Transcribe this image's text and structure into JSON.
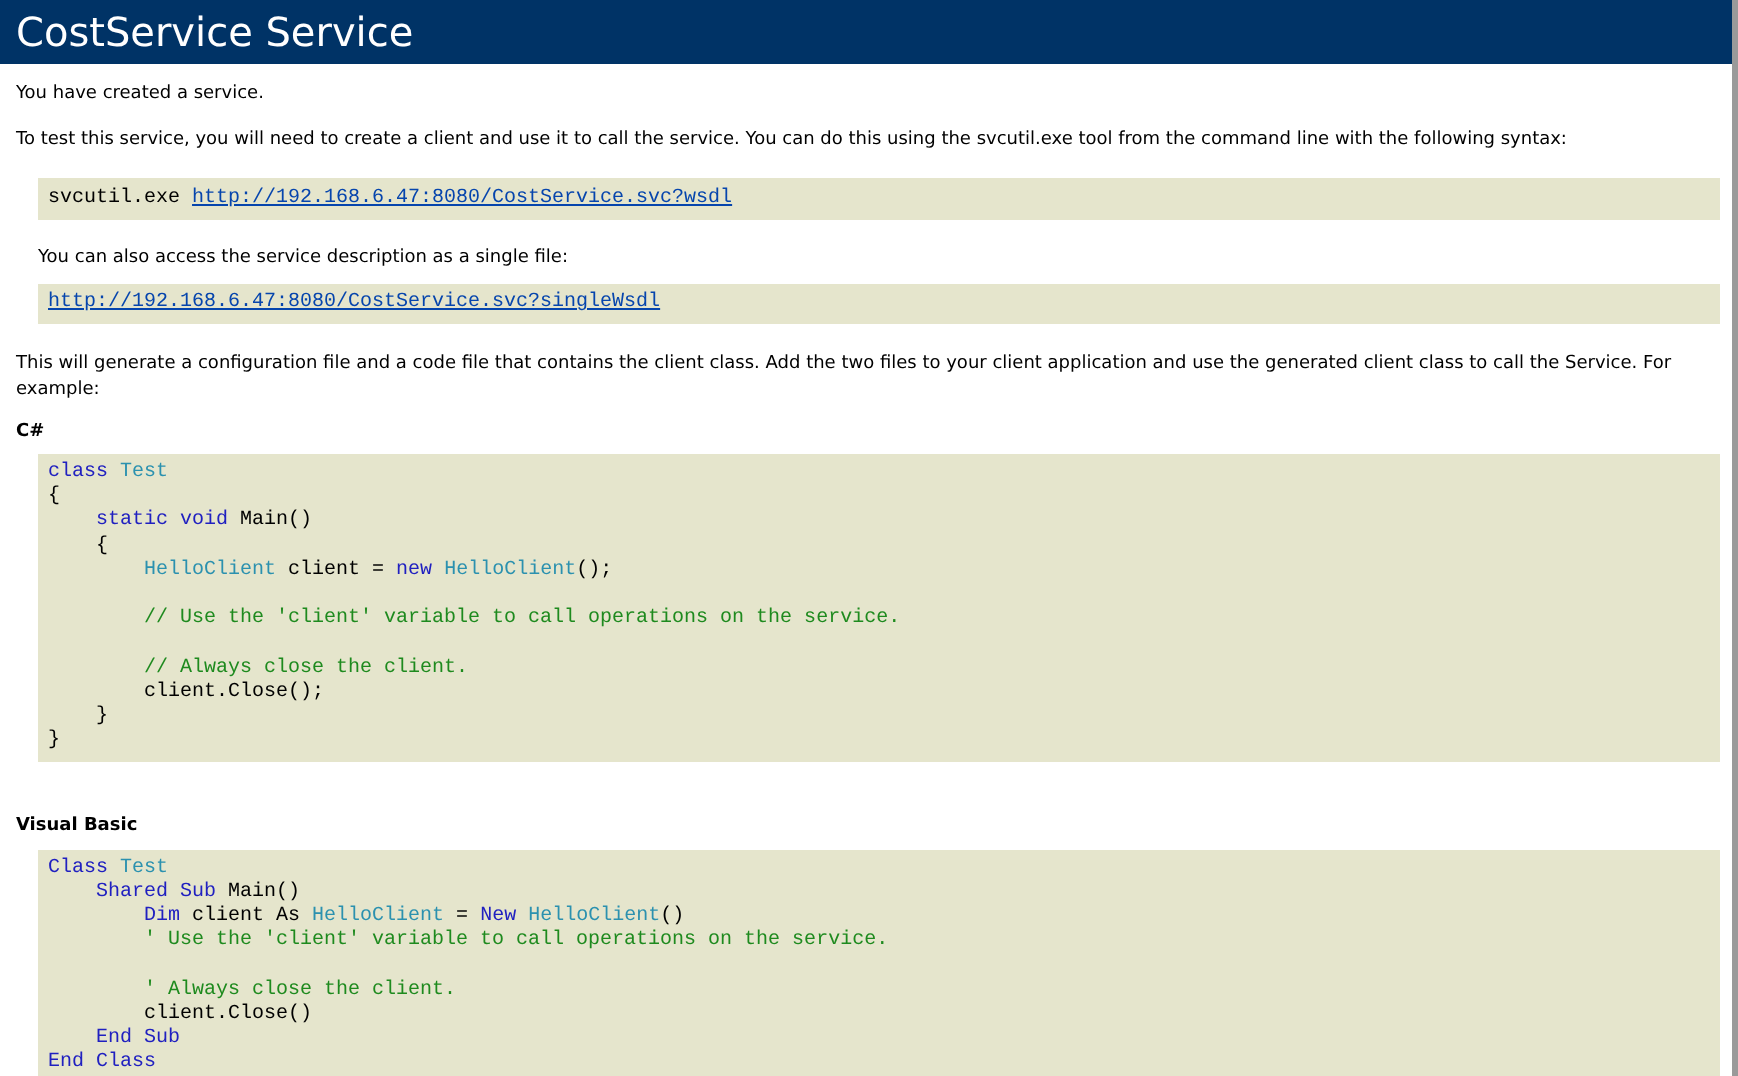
{
  "title": "CostService Service",
  "intro": "You have created a service.",
  "instructions": "To test this service, you will need to create a client and use it to call the service. You can do this using the svcutil.exe tool from the command line with the following syntax:",
  "command": {
    "text": "svcutil.exe",
    "link": "http://192.168.6.47:8080/CostService.svc?wsdl"
  },
  "single_file_note": "You can also access the service description as a single file:",
  "single_file_link": "http://192.168.6.47:8080/CostService.svc?singleWsdl",
  "generate_note": "This will generate a configuration file and a code file that contains the client class. Add the two files to your client application and use the generated client class to call the Service. For example:",
  "samples": [
    {
      "language": "C#",
      "lines": [
        [
          {
            "kind": "keyword",
            "text": "class"
          },
          {
            "kind": "type",
            "text": " Test"
          }
        ],
        [
          {
            "kind": "plain",
            "text": "{"
          }
        ],
        [
          {
            "kind": "keyword",
            "text": "    static void"
          },
          {
            "kind": "plain",
            "text": " Main()"
          }
        ],
        [
          {
            "kind": "plain",
            "text": "    {"
          }
        ],
        [
          {
            "kind": "type",
            "text": "        HelloClient"
          },
          {
            "kind": "plain",
            "text": " client = "
          },
          {
            "kind": "keyword",
            "text": "new"
          },
          {
            "kind": "type",
            "text": " HelloClient"
          },
          {
            "kind": "plain",
            "text": "();"
          }
        ],
        [
          {
            "kind": "blank"
          }
        ],
        [
          {
            "kind": "comment",
            "text": "        // Use the 'client' variable to call operations on the service."
          }
        ],
        [
          {
            "kind": "blank"
          }
        ],
        [
          {
            "kind": "comment",
            "text": "        // Always close the client."
          }
        ],
        [
          {
            "kind": "plain",
            "text": "        client.Close();"
          }
        ],
        [
          {
            "kind": "plain",
            "text": "    }"
          }
        ],
        [
          {
            "kind": "plain",
            "text": "}"
          }
        ]
      ]
    },
    {
      "language": "Visual Basic",
      "lines": [
        [
          {
            "kind": "keyword",
            "text": "Class"
          },
          {
            "kind": "type",
            "text": " Test"
          }
        ],
        [
          {
            "kind": "keyword",
            "text": "    Shared Sub"
          },
          {
            "kind": "plain",
            "text": " Main()"
          }
        ],
        [
          {
            "kind": "keyword",
            "text": "        Dim"
          },
          {
            "kind": "plain",
            "text": " client As "
          },
          {
            "kind": "type",
            "text": "HelloClient"
          },
          {
            "kind": "plain",
            "text": " = "
          },
          {
            "kind": "keyword",
            "text": "New"
          },
          {
            "kind": "type",
            "text": " HelloClient"
          },
          {
            "kind": "plain",
            "text": "()"
          }
        ],
        [
          {
            "kind": "comment",
            "text": "        ' Use the 'client' variable to call operations on the service."
          }
        ],
        [
          {
            "kind": "blank"
          }
        ],
        [
          {
            "kind": "comment",
            "text": "        ' Always close the client."
          }
        ],
        [
          {
            "kind": "plain",
            "text": "        client.Close()"
          }
        ],
        [
          {
            "kind": "keyword",
            "text": "    End Sub"
          }
        ],
        [
          {
            "kind": "keyword",
            "text": "End Class"
          }
        ]
      ]
    }
  ]
}
